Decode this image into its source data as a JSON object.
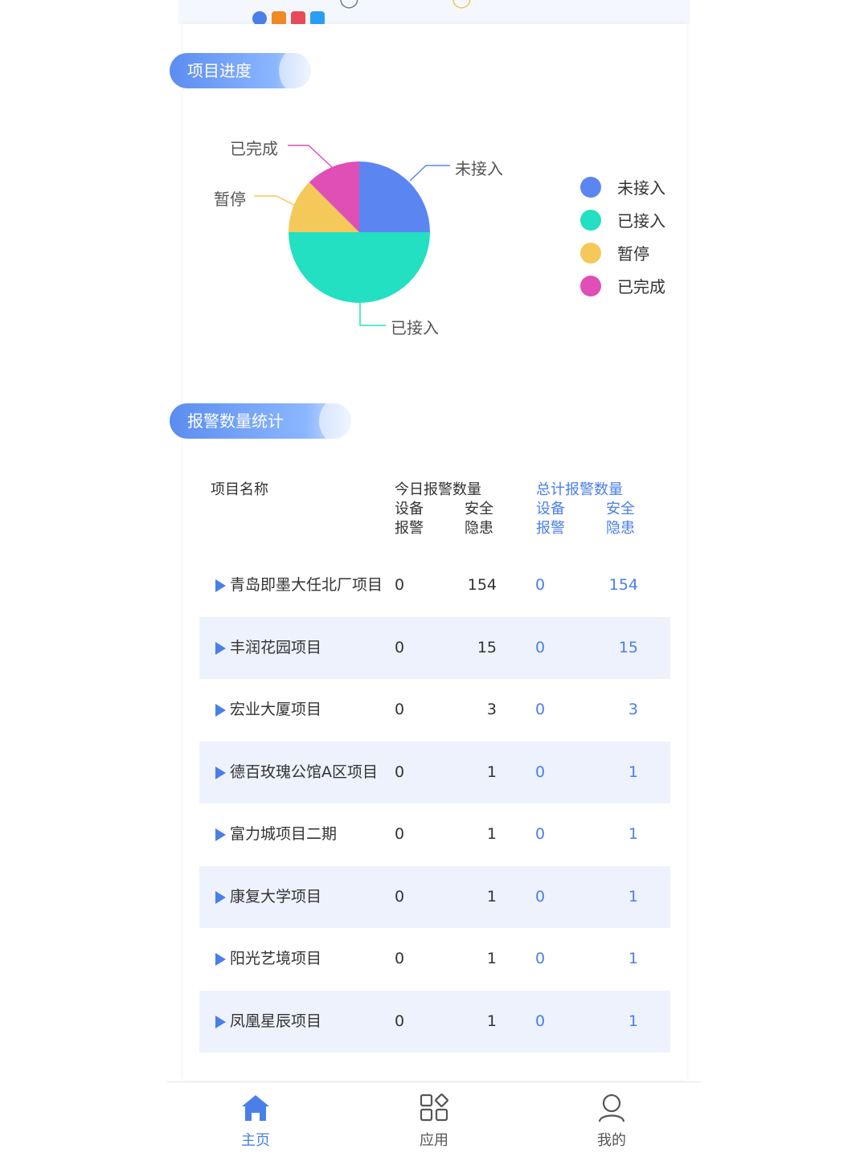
{
  "sections": {
    "progress_title": "项目进度",
    "alarm_title": "报警数量统计"
  },
  "chart_data": {
    "type": "pie",
    "slices": [
      {
        "label": "未接入",
        "value": 25,
        "color": "#5b86f2"
      },
      {
        "label": "已接入",
        "value": 50,
        "color": "#22e0c1"
      },
      {
        "label": "暂停",
        "value": 12.5,
        "color": "#f5c85a"
      },
      {
        "label": "已完成",
        "value": 12.5,
        "color": "#df4fb5"
      }
    ],
    "legend": [
      "未接入",
      "已接入",
      "暂停",
      "已完成"
    ],
    "legend_placement": "right"
  },
  "table": {
    "col_name": "项目名称",
    "today_header": "今日报警数量",
    "total_header": "总计报警数量",
    "sub_device_1": "设备",
    "sub_device_2": "报警",
    "sub_safety_1": "安全",
    "sub_safety_2": "隐患",
    "rows": [
      {
        "name": "青岛即墨大任北厂项目",
        "today_device": "0",
        "today_safety": "154",
        "total_device": "0",
        "total_safety": "154"
      },
      {
        "name": "丰润花园项目",
        "today_device": "0",
        "today_safety": "15",
        "total_device": "0",
        "total_safety": "15"
      },
      {
        "name": "宏业大厦项目",
        "today_device": "0",
        "today_safety": "3",
        "total_device": "0",
        "total_safety": "3"
      },
      {
        "name": "德百玫瑰公馆A区项目",
        "today_device": "0",
        "today_safety": "1",
        "total_device": "0",
        "total_safety": "1"
      },
      {
        "name": "富力城项目二期",
        "today_device": "0",
        "today_safety": "1",
        "total_device": "0",
        "total_safety": "1"
      },
      {
        "name": "康复大学项目",
        "today_device": "0",
        "today_safety": "1",
        "total_device": "0",
        "total_safety": "1"
      },
      {
        "name": "阳光艺境项目",
        "today_device": "0",
        "today_safety": "1",
        "total_device": "0",
        "total_safety": "1"
      },
      {
        "name": "凤凰星辰项目",
        "today_device": "0",
        "today_safety": "1",
        "total_device": "0",
        "total_safety": "1"
      }
    ]
  },
  "nav": {
    "home": "主页",
    "apps": "应用",
    "mine": "我的"
  },
  "colors": {
    "accent": "#4a7fe8",
    "row_shade": "#eef2fd"
  },
  "icons": [
    "home-icon",
    "apps-icon",
    "user-icon"
  ]
}
